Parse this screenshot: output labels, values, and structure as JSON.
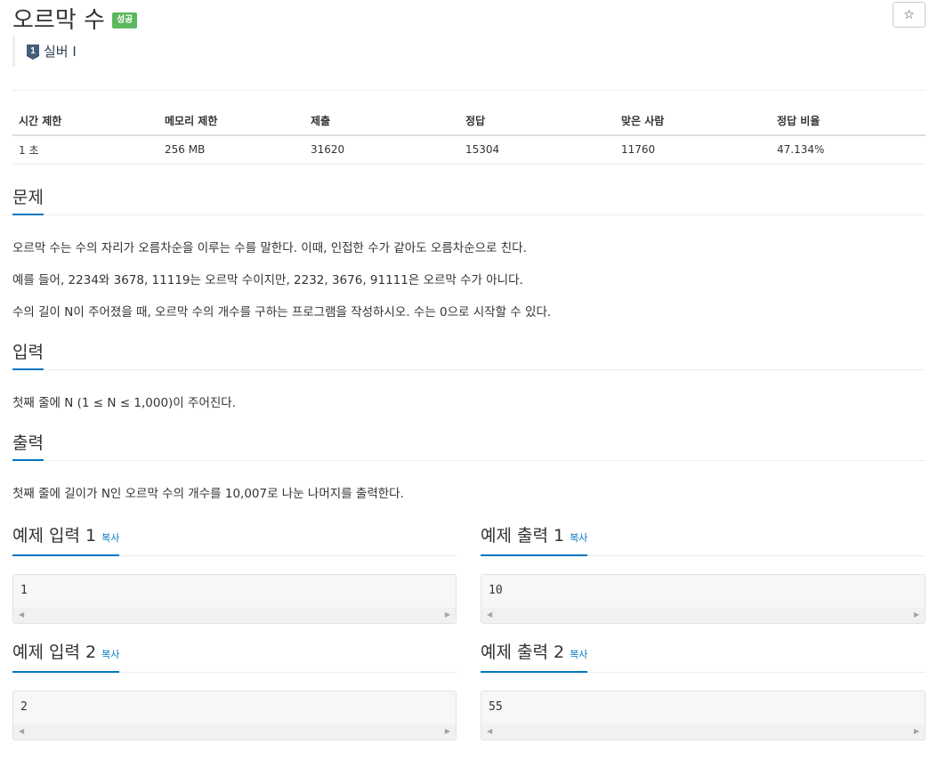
{
  "header": {
    "title": "오르막 수",
    "result_badge": "성공",
    "star_icon": "☆",
    "tier_label": "실버 I",
    "tier_icon_number": "1"
  },
  "info_table": {
    "headers": [
      "시간 제한",
      "메모리 제한",
      "제출",
      "정답",
      "맞은 사람",
      "정답 비율"
    ],
    "values": [
      "1 초",
      "256 MB",
      "31620",
      "15304",
      "11760",
      "47.134%"
    ]
  },
  "problem": {
    "heading": "문제",
    "lines": [
      "오르막 수는 수의 자리가 오름차순을 이루는 수를 말한다. 이때, 인접한 수가 같아도 오름차순으로 친다.",
      "예를 들어, 2234와 3678, 11119는 오르막 수이지만, 2232, 3676, 91111은 오르막 수가 아니다.",
      "수의 길이 N이 주어졌을 때, 오르막 수의 개수를 구하는 프로그램을 작성하시오. 수는 0으로 시작할 수 있다."
    ]
  },
  "input": {
    "heading": "입력",
    "text": "첫째 줄에 N (1 ≤ N ≤ 1,000)이 주어진다."
  },
  "output": {
    "heading": "출력",
    "text": "첫째 줄에 길이가 N인 오르막 수의 개수를 10,007로 나눈 나머지를 출력한다."
  },
  "samples": {
    "copy_label": "복사",
    "input1_title": "예제 입력 1",
    "input1_value": "1",
    "output1_title": "예제 출력 1",
    "output1_value": "10",
    "input2_title": "예제 입력 2",
    "input2_value": "2",
    "output2_title": "예제 출력 2",
    "output2_value": "55"
  },
  "colors": {
    "accent": "#0076c0",
    "success_badge": "#5cb85c",
    "tier_icon": "#435f7a"
  }
}
